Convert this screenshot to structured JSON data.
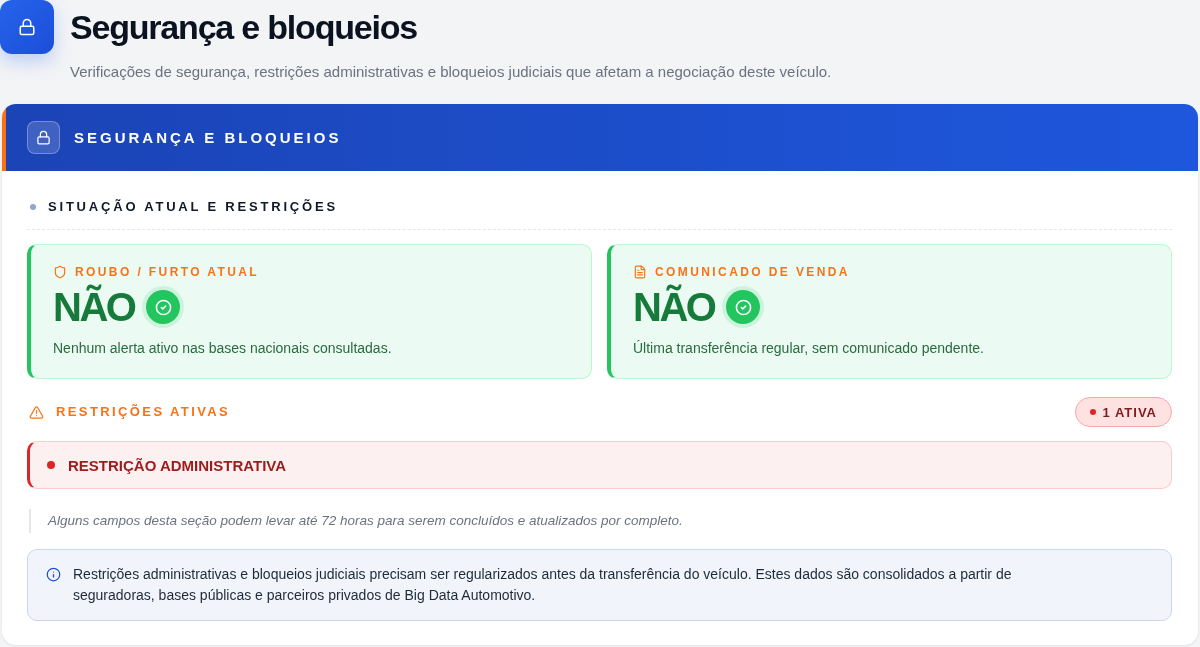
{
  "header": {
    "title": "Segurança e bloqueios",
    "subtitle": "Verificações de segurança, restrições administrativas e bloqueios judiciais que afetam a negociação deste veículo."
  },
  "panel": {
    "title": "SEGURANÇA E BLOQUEIOS",
    "section_title": "SITUAÇÃO ATUAL E RESTRIÇÕES",
    "status_cards": [
      {
        "kind": "theft",
        "label": "ROUBO / FURTO ATUAL",
        "value": "NÃO",
        "ok": true,
        "description": "Nenhum alerta ativo nas bases nacionais consultadas."
      },
      {
        "kind": "sale_notice",
        "label": "COMUNICADO DE VENDA",
        "value": "NÃO",
        "ok": true,
        "description": "Última transferência regular, sem comunicado pendente."
      }
    ],
    "restrictions": {
      "title": "RESTRIÇÕES ATIVAS",
      "badge": "1 ATIVA",
      "items": [
        {
          "label": "RESTRIÇÃO ADMINISTRATIVA"
        }
      ]
    },
    "note": "Alguns campos desta seção podem levar até 72 horas para serem concluídos e atualizados por completo.",
    "info": "Restrições administrativas e bloqueios judiciais precisam ser regularizados antes da transferência do veículo. Estes dados são consolidados a partir de seguradoras, bases públicas e parceiros privados de Big Data Automotivo."
  }
}
